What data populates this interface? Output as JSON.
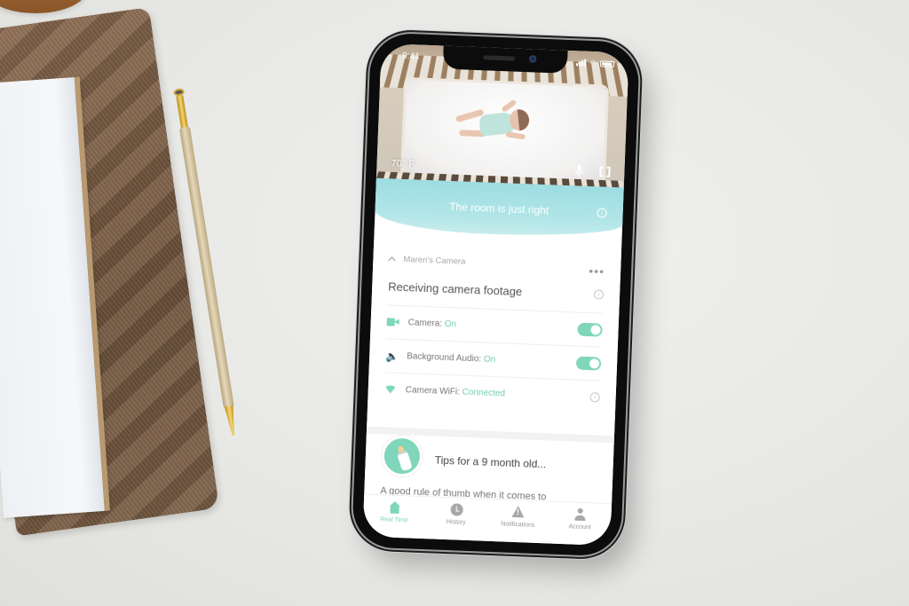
{
  "status_bar": {
    "time": "9:41",
    "icons": [
      "signal-icon",
      "wifi-icon",
      "battery-icon"
    ]
  },
  "camera_feed": {
    "temperature": "70° F",
    "controls": [
      "microphone-icon",
      "fullscreen-icon"
    ]
  },
  "room_status": {
    "message": "The room is just right",
    "icon": "info-icon"
  },
  "camera_card": {
    "camera_name": "Maren's Camera",
    "menu_icon": "more-dots-icon",
    "status_title": "Receiving camera footage",
    "settings": [
      {
        "label": "Camera:",
        "value": "On",
        "icon": "video-camera-icon",
        "control": "toggle",
        "enabled": true
      },
      {
        "label": "Background Audio:",
        "value": "On",
        "icon": "speaker-icon",
        "control": "toggle",
        "enabled": true
      },
      {
        "label": "Camera WiFi:",
        "value": "Connected",
        "icon": "wifi-icon",
        "control": "info"
      }
    ]
  },
  "tips": {
    "icon": "baby-bottle-icon",
    "title": "Tips for a 9 month old...",
    "preview": "A good rule of thumb when it comes to"
  },
  "tab_bar": {
    "tabs": [
      {
        "label": "Real Time",
        "icon": "home-icon",
        "active": true
      },
      {
        "label": "History",
        "icon": "clock-icon",
        "active": false
      },
      {
        "label": "Notifications",
        "icon": "warning-icon",
        "active": false
      },
      {
        "label": "Account",
        "icon": "user-icon",
        "active": false
      }
    ]
  },
  "colors": {
    "accent": "#7fd6bb",
    "banner": "#a8e1e5",
    "text_primary": "#555555",
    "text_muted": "#a7a7a7"
  }
}
